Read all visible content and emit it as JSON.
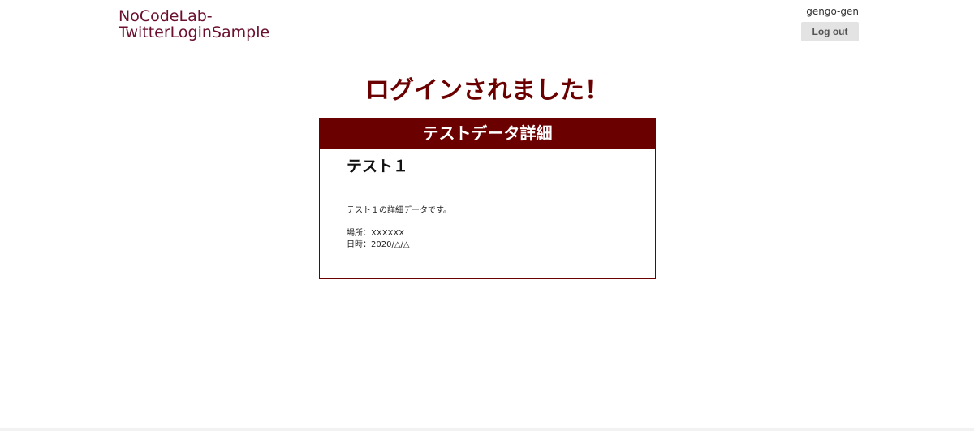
{
  "header": {
    "brand_line1": "NoCodeLab-",
    "brand_line2": "TwitterLoginSample",
    "username": "gengo-gen",
    "logout_label": "Log out"
  },
  "main": {
    "headline": "ログインされました！",
    "card": {
      "header_label": "テストデータ詳細",
      "title": "テスト１",
      "description": "テスト１の詳細データです。",
      "place": "場所：XXXXXX",
      "datetime": "日時：2020/△/△"
    }
  },
  "colors": {
    "brand": "#6b0f2e",
    "accent": "#6b0000",
    "button_bg": "#e3e3e3"
  }
}
